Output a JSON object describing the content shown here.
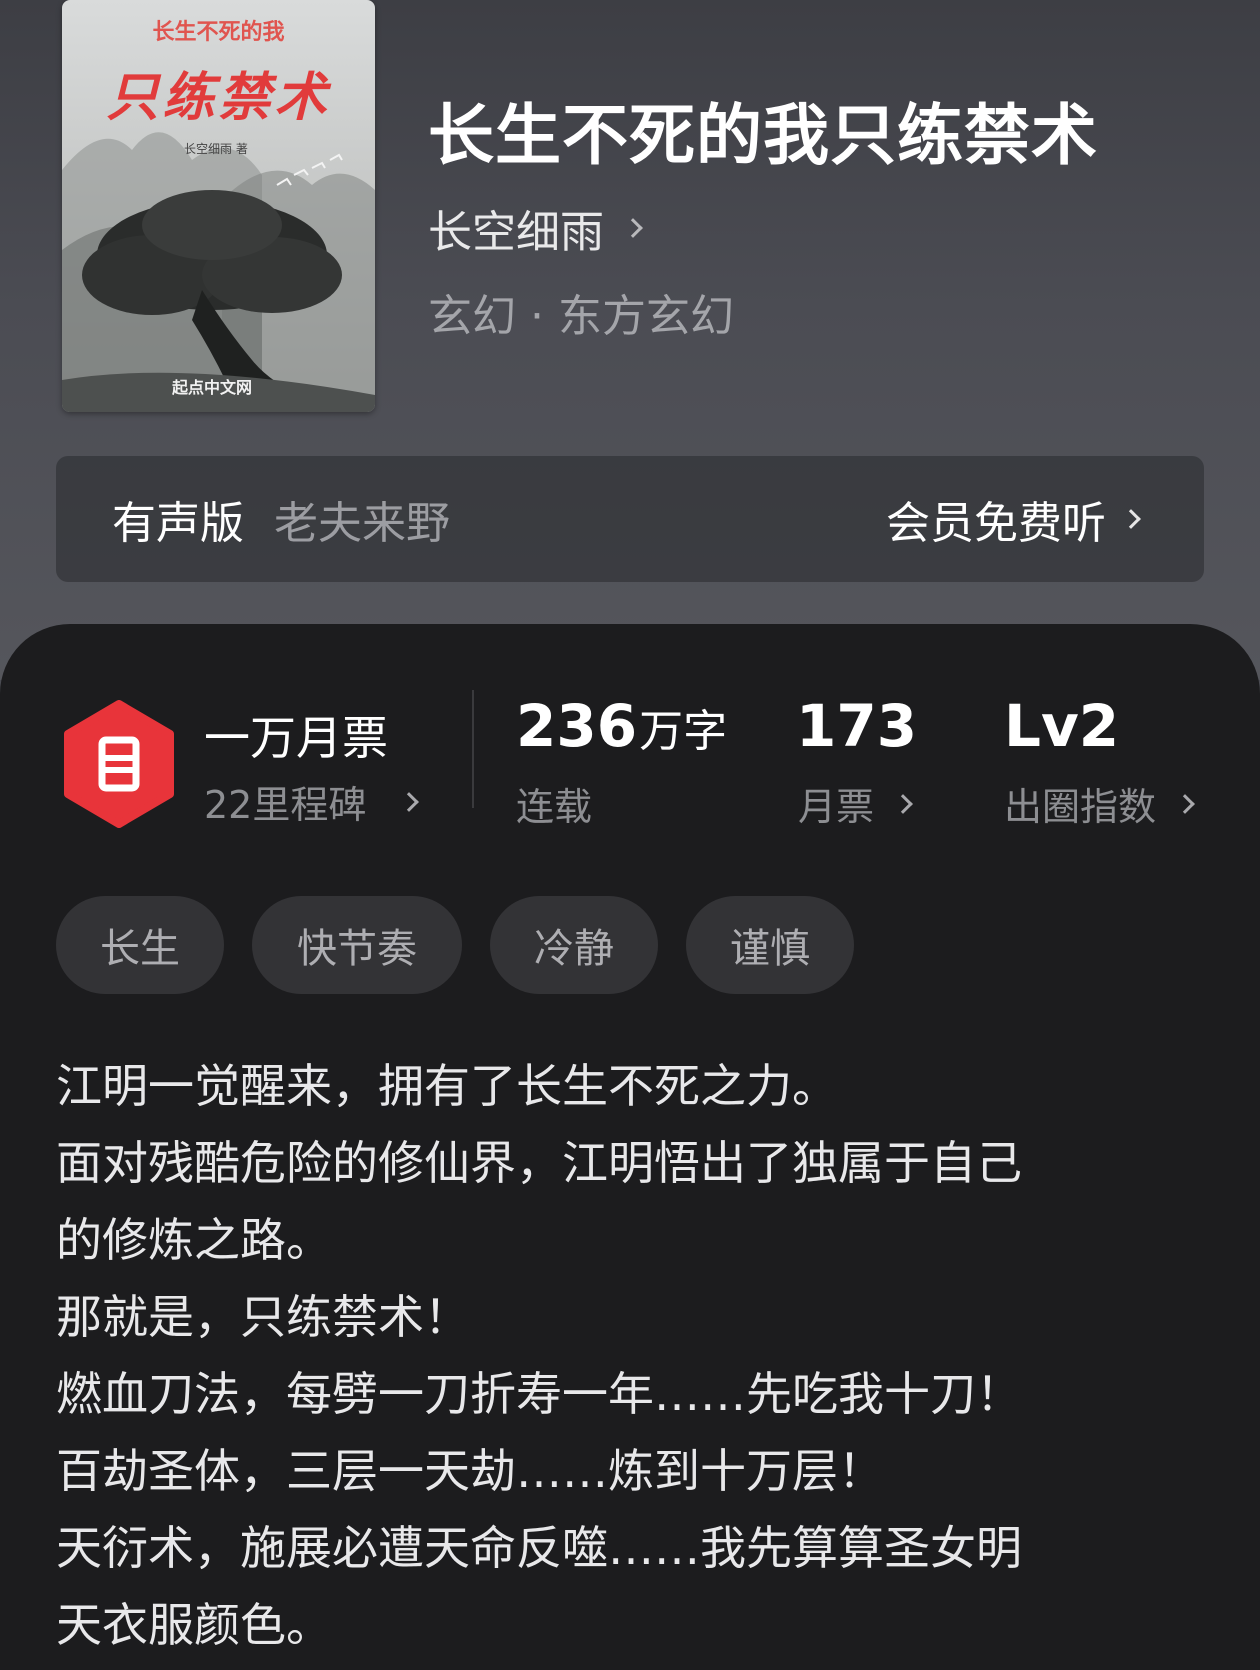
{
  "cover": {
    "top_title": "长生不死的我",
    "main_title": "只练禁术",
    "author": "长空细雨 著",
    "publisher": "起点中文网"
  },
  "book": {
    "title": "长生不死的我只练禁术",
    "author": "长空细雨",
    "genre": "玄幻 · 东方玄幻"
  },
  "audio": {
    "label": "有声版",
    "narrator": "老夫来野",
    "action": "会员免费听"
  },
  "stats": {
    "ticket_title": "一万月票",
    "ticket_sub": "22里程碑",
    "words_value": "236",
    "words_unit": "万字",
    "words_label": "连载",
    "monthly_value": "173",
    "monthly_label": "月票",
    "index_value": "Lv2",
    "index_label": "出圈指数"
  },
  "tags": [
    "长生",
    "快节奏",
    "冷静",
    "谨慎"
  ],
  "description": [
    "江明一觉醒来，拥有了长生不死之力。",
    "面对残酷危险的修仙界，江明悟出了独属于自己",
    "的修炼之路。",
    "那就是，只练禁术！",
    "燃血刀法，每劈一刀折寿一年……先吃我十刀！",
    "百劫圣体，三层一天劫……炼到十万层！",
    "天衍术，施展必遭天命反噬……我先算算圣女明",
    "天衣服颜色。"
  ],
  "colors": {
    "badge_red": "#e8343a",
    "sheet_bg": "#1c1c1e",
    "tag_bg": "#333336"
  }
}
